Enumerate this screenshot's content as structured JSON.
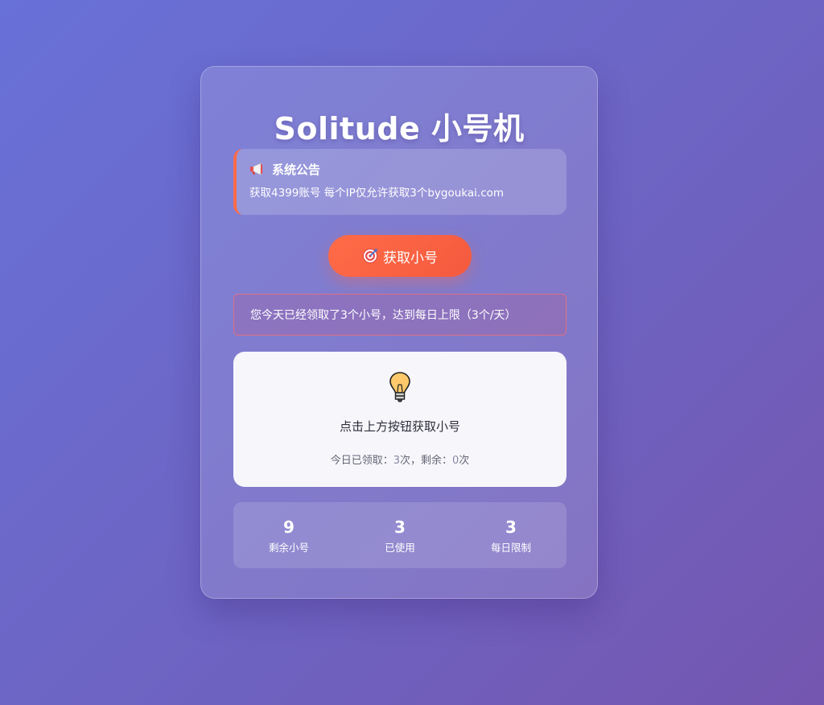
{
  "app": {
    "title": "Solitude 小号机"
  },
  "notice": {
    "icon": "megaphone-icon",
    "heading": "系统公告",
    "text": "获取4399账号 每个IP仅允许获取3个bygoukai.com"
  },
  "action": {
    "icon": "target-icon",
    "label": "获取小号"
  },
  "alert": {
    "text": "您今天已经领取了3个小号，达到每日上限（3个/天）"
  },
  "result_panel": {
    "icon": "lightbulb-icon",
    "message": "点击上方按钮获取小号",
    "usage_prefix": "今日已领取：",
    "used_count": "3",
    "usage_mid": "次，剩余：",
    "remaining_count": "0",
    "usage_suffix": "次"
  },
  "stats": [
    {
      "value": "9",
      "label": "剩余小号"
    },
    {
      "value": "3",
      "label": "已使用"
    },
    {
      "value": "3",
      "label": "每日限制"
    }
  ],
  "colors": {
    "accent": "#ff6b47",
    "alert_border": "#ff6e6e",
    "background_start": "#6871d8",
    "background_end": "#7456b0"
  }
}
